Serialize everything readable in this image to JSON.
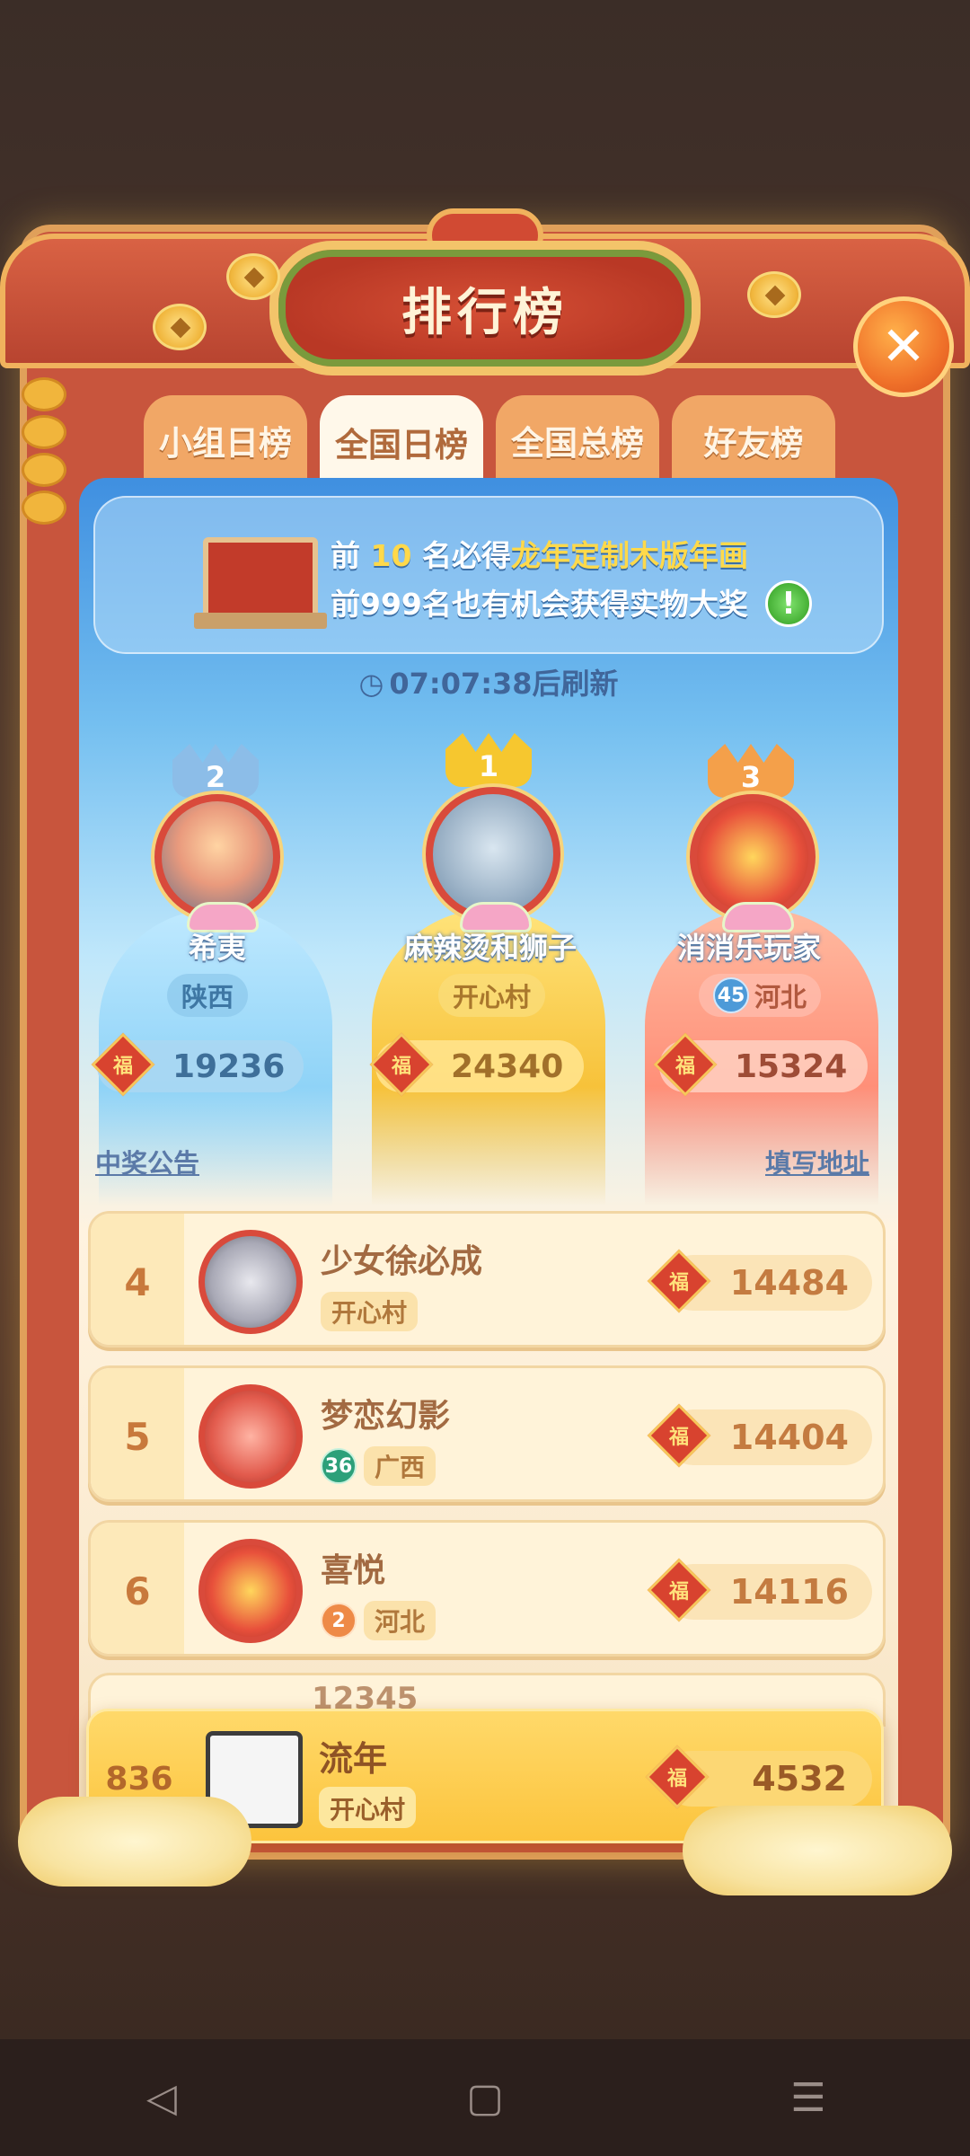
{
  "title": "排行榜",
  "tabs": [
    {
      "label": "小组日榜",
      "active": false
    },
    {
      "label": "全国日榜",
      "active": true
    },
    {
      "label": "全国总榜",
      "active": false
    },
    {
      "label": "好友榜",
      "active": false
    }
  ],
  "banner": {
    "line1_prefix": "前",
    "line1_number": "10",
    "line1_mid": "名必得",
    "line1_prize": "龙年定制木版年画",
    "line2": "前999名也有机会获得实物大奖",
    "info": "!"
  },
  "timer": "07:07:38后刷新",
  "fu_label": "福",
  "podium": [
    {
      "rank": "2",
      "name": "希夷",
      "location": "陕西",
      "level": "",
      "score": "19236"
    },
    {
      "rank": "1",
      "name": "麻辣烫和狮子",
      "location": "开心村",
      "level": "",
      "score": "24340"
    },
    {
      "rank": "3",
      "name": "消消乐玩家",
      "location": "河北",
      "level": "45",
      "score": "15324"
    }
  ],
  "links": {
    "left": "中奖公告",
    "right": "填写地址"
  },
  "rows": [
    {
      "rank": "4",
      "name": "少女徐必成",
      "location": "开心村",
      "level": "",
      "score": "14484"
    },
    {
      "rank": "5",
      "name": "梦恋幻影",
      "location": "广西",
      "level": "36",
      "score": "14404"
    },
    {
      "rank": "6",
      "name": "喜悦",
      "location": "河北",
      "level": "2",
      "score": "14116"
    }
  ],
  "hidden_row_name": "12345",
  "me": {
    "rank": "836",
    "name": "流年",
    "location": "开心村",
    "score": "4532"
  },
  "nav": {
    "back": "◁",
    "home": "▢",
    "menu": "☰"
  },
  "colors": {
    "frame": "#c8553d",
    "gold": "#f3c46a",
    "accent": "#d8432f"
  }
}
